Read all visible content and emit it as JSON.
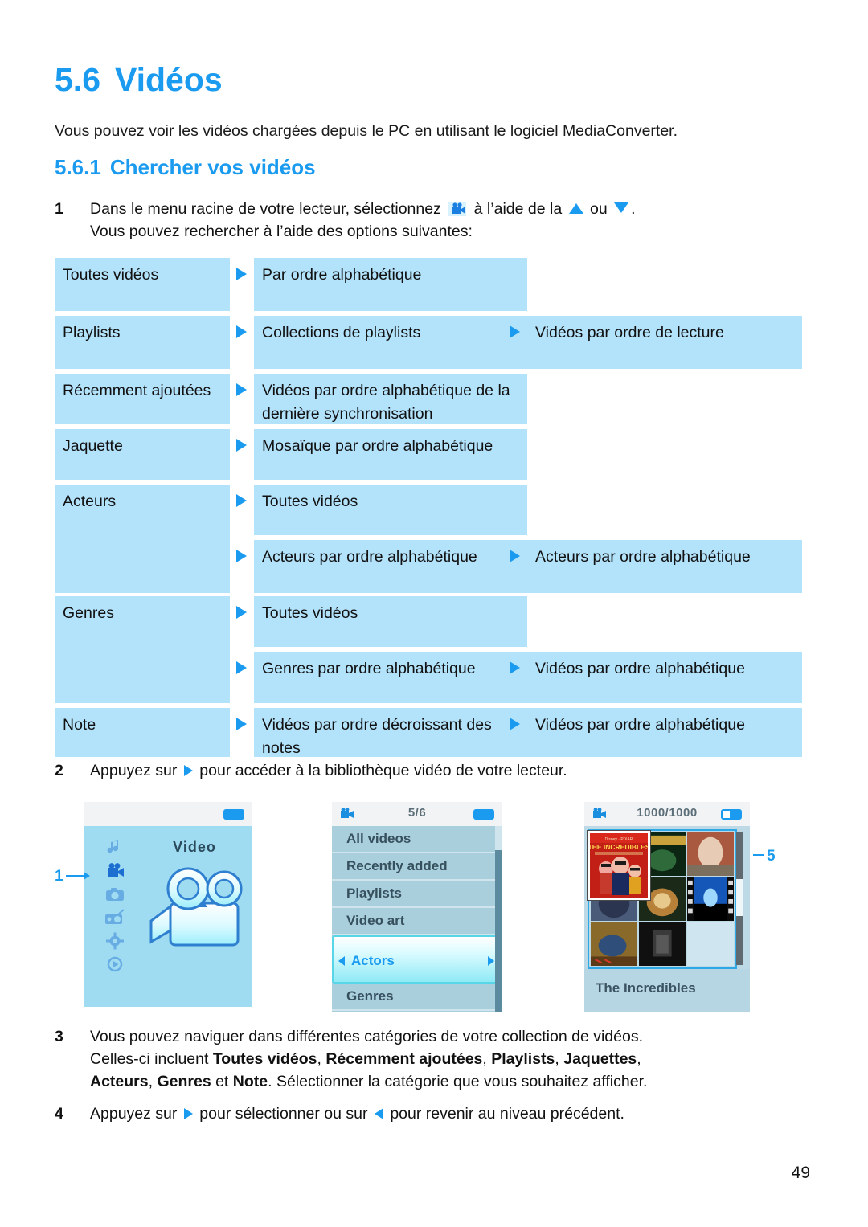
{
  "document": {
    "section_number": "5.6",
    "section_title": "Vidéos",
    "intro": "Vous pouvez voir les vidéos chargées depuis le PC en utilisant le logiciel MediaConverter.",
    "subsection_number": "5.6.1",
    "subsection_title": "Chercher vos vidéos",
    "page_number": "49",
    "accent_color": "#1a9bf0",
    "table_cell_color": "#b3e2fb"
  },
  "steps": {
    "s1": {
      "number": "1",
      "part_a": "Dans le menu racine de votre lecteur, sélectionnez",
      "part_b": "à l’aide de la",
      "part_c": "ou",
      "part_d": ".",
      "line2": "Vous pouvez rechercher à l’aide des options suivantes:"
    },
    "s2": {
      "number": "2",
      "part_a": "Appuyez sur",
      "part_b": "pour accéder à la bibliothèque vidéo de votre lecteur."
    },
    "s3": {
      "number": "3",
      "line1": "Vous pouvez naviguer dans différentes catégories de votre collection de vidéos.",
      "line2_lead": "Celles-ci incluent ",
      "b1": "Toutes vidéos",
      "b2": "Récemment ajoutées",
      "b3": "Playlists",
      "b4": "Jaquettes",
      "b5": "Acteurs",
      "b6": "Genres",
      "b7": "Note",
      "mid": " et ",
      "tail": ". Sélectionner la catégorie que vous souhaitez afficher."
    },
    "s4": {
      "number": "4",
      "part_a": "Appuyez sur",
      "part_b": "pour sélectionner ou sur",
      "part_c": "pour revenir au niveau précédent."
    }
  },
  "options_table": {
    "rows": [
      {
        "col1": "Toutes vidéos",
        "col2": "Par ordre alphabétique",
        "col3": ""
      },
      {
        "col1": "Playlists",
        "col2": "Collections de playlists",
        "col3": "Vidéos par ordre de lecture"
      },
      {
        "col1": "Récemment ajoutées",
        "col2": "Vidéos par ordre alphabétique de la dernière synchronisation",
        "col3": ""
      },
      {
        "col1": "Jaquette",
        "col2": "Mosaïque par ordre alphabétique",
        "col3": ""
      },
      {
        "col1": "Acteurs",
        "col2": "Toutes vidéos",
        "col3": ""
      },
      {
        "col1": "",
        "col2": "Acteurs par ordre alphabétique",
        "col3": "Acteurs par ordre alphabétique"
      },
      {
        "col1": "Genres",
        "col2": "Toutes vidéos",
        "col3": ""
      },
      {
        "col1": "",
        "col2": "Genres par ordre alphabétique",
        "col3": "Vidéos par ordre alphabétique"
      },
      {
        "col1": "Note",
        "col2": "Vidéos par ordre décroissant des notes",
        "col3": "Vidéos par ordre alphabétique"
      }
    ]
  },
  "screens": {
    "screen1": {
      "label": "Video",
      "callout": "1",
      "rail_icons": [
        "music-note-icon",
        "video-camera-icon",
        "camera-icon",
        "radio-icon",
        "gear-icon",
        "play-circle-icon"
      ],
      "selected_rail_index": 1,
      "battery": "battery-icon"
    },
    "screen2": {
      "status_count": "5/6",
      "header_icon": "video-camera-icon",
      "battery": "battery-icon",
      "items": [
        "All videos",
        "Recently added",
        "Playlists",
        "Video art",
        "Actors",
        "Genres"
      ],
      "selected_item": "Actors"
    },
    "screen3": {
      "status_count": "1000/1000",
      "header_icon": "video-camera-icon",
      "battery": "battery-half-icon",
      "selected_title": "The Incredibles",
      "callout": "5"
    }
  }
}
